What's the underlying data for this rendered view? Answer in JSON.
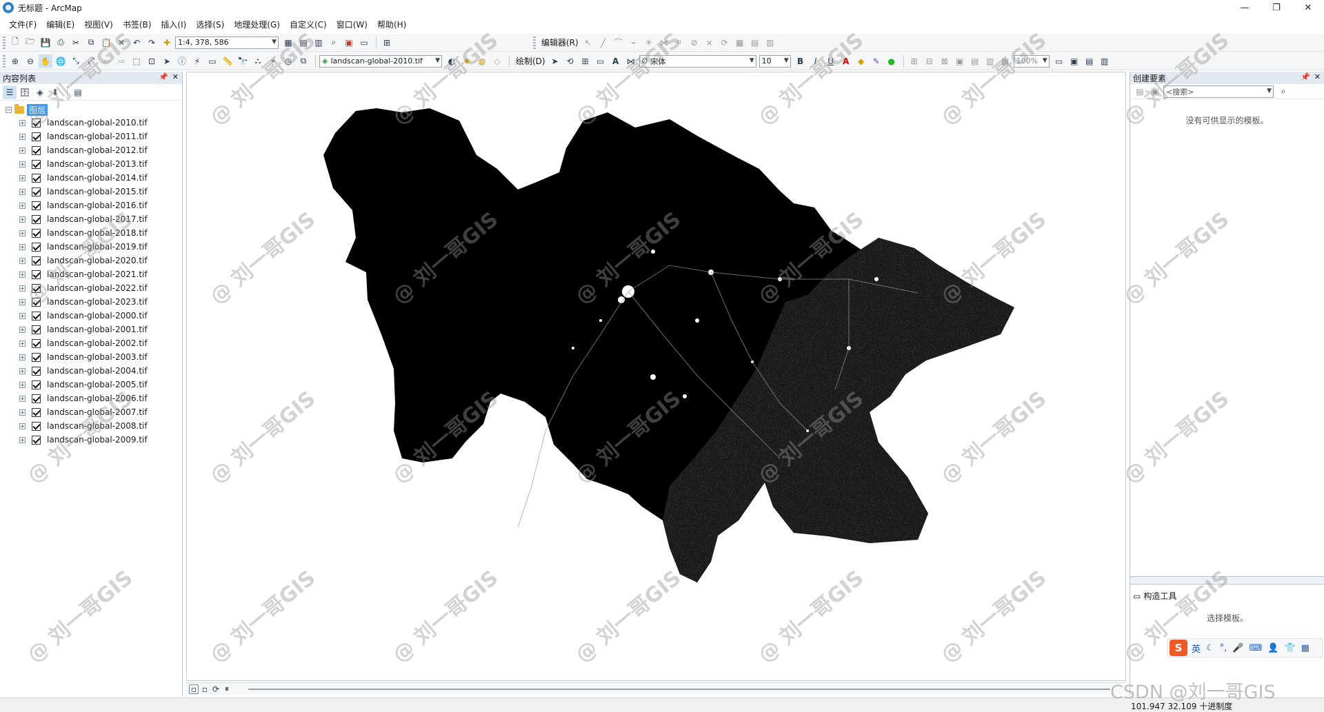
{
  "window": {
    "title": "无标题 - ArcMap",
    "minimize": "—",
    "maximize": "❐",
    "close": "✕"
  },
  "menu": [
    "文件(F)",
    "编辑(E)",
    "视图(V)",
    "书签(B)",
    "插入(I)",
    "选择(S)",
    "地理处理(G)",
    "自定义(C)",
    "窗口(W)",
    "帮助(H)"
  ],
  "toolbar": {
    "scale": "1:4, 378, 586",
    "editor_label": "编辑器(R)",
    "layer_select": "landscan-global-2010.tif",
    "draw_label": "绘制(D)",
    "font_name": "宋体",
    "font_size": "10",
    "zoom_percent": "100%"
  },
  "toc": {
    "title": "内容列表",
    "root_label": "图层",
    "layers": [
      "landscan-global-2010.tif",
      "landscan-global-2011.tif",
      "landscan-global-2012.tif",
      "landscan-global-2013.tif",
      "landscan-global-2014.tif",
      "landscan-global-2015.tif",
      "landscan-global-2016.tif",
      "landscan-global-2017.tif",
      "landscan-global-2018.tif",
      "landscan-global-2019.tif",
      "landscan-global-2020.tif",
      "landscan-global-2021.tif",
      "landscan-global-2022.tif",
      "landscan-global-2023.tif",
      "landscan-global-2000.tif",
      "landscan-global-2001.tif",
      "landscan-global-2002.tif",
      "landscan-global-2003.tif",
      "landscan-global-2004.tif",
      "landscan-global-2005.tif",
      "landscan-global-2006.tif",
      "landscan-global-2007.tif",
      "landscan-global-2008.tif",
      "landscan-global-2009.tif"
    ]
  },
  "right_panel": {
    "title": "创建要素",
    "search_placeholder": "<搜索>",
    "empty_message": "没有可供显示的模板。",
    "sub_title": "构造工具",
    "sub_message": "选择模板。"
  },
  "ime": {
    "logo": "S",
    "lang": "英"
  },
  "status": {
    "coords": "101.947  32.109 十进制度"
  },
  "watermark": {
    "text": "@ 刘一哥GIS",
    "csdn": "CSDN @刘一哥GIS"
  },
  "colors": {
    "selection": "#3399ff",
    "raster_bg": "#000000",
    "raster_light": "#ffffff"
  }
}
